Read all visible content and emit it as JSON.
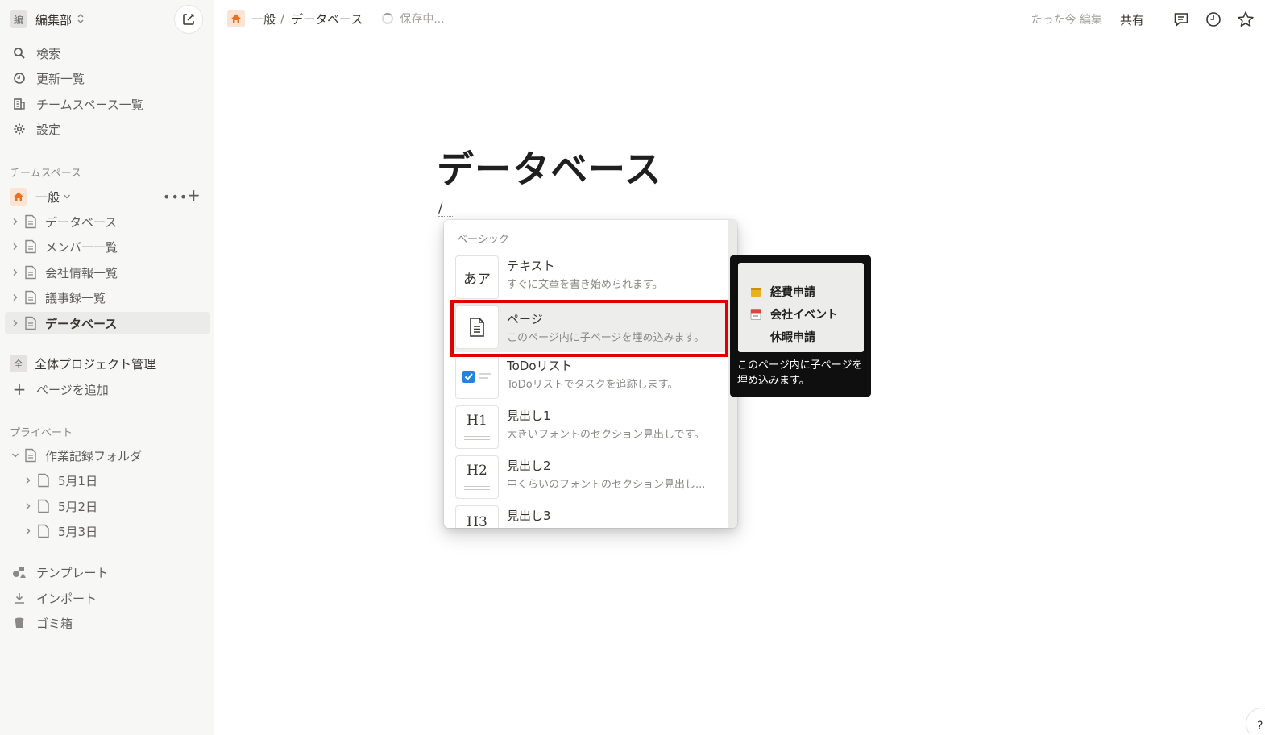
{
  "workspace": {
    "badge": "編",
    "name": "編集部"
  },
  "sidebar": {
    "nav": [
      {
        "label": "検索",
        "icon": "search-icon"
      },
      {
        "label": "更新一覧",
        "icon": "clock-icon"
      },
      {
        "label": "チームスペース一覧",
        "icon": "building-icon"
      },
      {
        "label": "設定",
        "icon": "gear-icon"
      }
    ],
    "teamspace_label": "チームスペース",
    "team": {
      "name": "一般"
    },
    "team_pages": [
      {
        "label": "データベース"
      },
      {
        "label": "メンバー一覧"
      },
      {
        "label": "会社情報一覧"
      },
      {
        "label": "議事録一覧"
      },
      {
        "label": "データベース"
      }
    ],
    "project": {
      "badge": "全",
      "label": "全体プロジェクト管理"
    },
    "add_page": "ページを追加",
    "private_label": "プライベート",
    "private_folder": "作業記録フォルダ",
    "private_pages": [
      {
        "label": "5月1日"
      },
      {
        "label": "5月2日"
      },
      {
        "label": "5月3日"
      }
    ],
    "bottom": [
      {
        "label": "テンプレート",
        "icon": "shapes-icon"
      },
      {
        "label": "インポート",
        "icon": "download-icon"
      },
      {
        "label": "ゴミ箱",
        "icon": "trash-icon"
      }
    ]
  },
  "topbar": {
    "breadcrumb": [
      "一般",
      "/",
      "データベース"
    ],
    "saving": "保存中...",
    "edited": "たった今 編集",
    "share": "共有"
  },
  "page": {
    "title": "データベース",
    "slash": "/"
  },
  "slash_menu": {
    "section": "ベーシック",
    "items": [
      {
        "thumb": "あア",
        "title": "テキスト",
        "desc": "すぐに文章を書き始められます。"
      },
      {
        "thumb": "page",
        "title": "ページ",
        "desc": "このページ内に子ページを埋め込みます。"
      },
      {
        "thumb": "todo",
        "title": "ToDoリスト",
        "desc": "ToDoリストでタスクを追跡します。"
      },
      {
        "thumb": "H1",
        "title": "見出し1",
        "desc": "大きいフォントのセクション見出しです。"
      },
      {
        "thumb": "H2",
        "title": "見出し2",
        "desc": "中くらいのフォントのセクション見出し..."
      },
      {
        "thumb": "H3",
        "title": "見出し3",
        "desc": ""
      }
    ]
  },
  "preview": {
    "items": [
      "経費申請",
      "会社イベント",
      "休暇申請"
    ],
    "text": "このページ内に子ページを埋め込みます。"
  },
  "help": "?",
  "colors": {
    "highlight": "#e00000",
    "home": "#e8731e",
    "accent": "#2383e2"
  }
}
